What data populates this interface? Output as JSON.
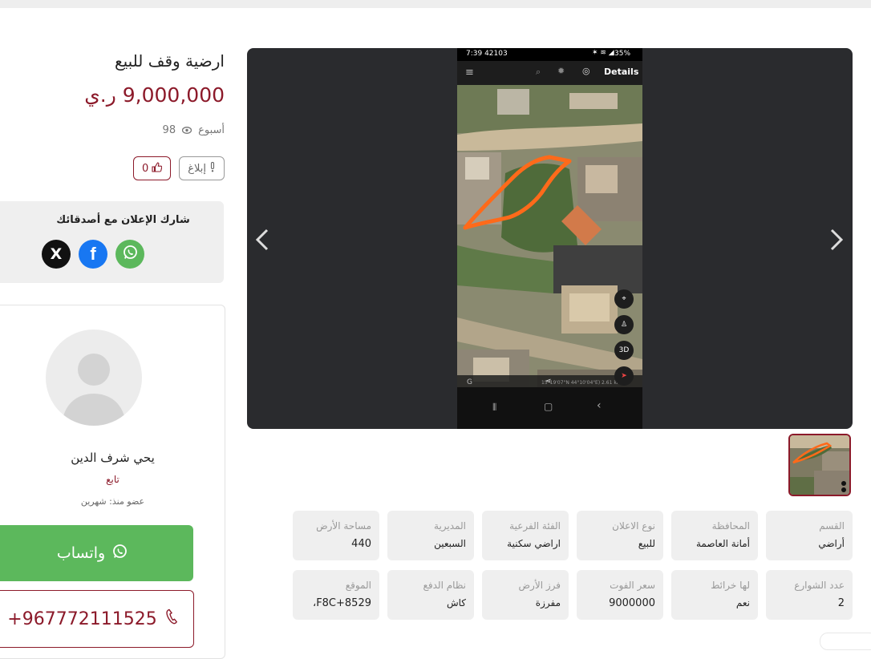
{
  "listing": {
    "title": "ارضية وقف للبيع",
    "price": "9,000,000 ر.ي",
    "posted": "أسبوع",
    "views": "98",
    "report_label": "إبلاغ",
    "likes": "0"
  },
  "share": {
    "title": "شارك الإعلان مع أصدقائك",
    "x_label": "X",
    "facebook_label": "f"
  },
  "seller": {
    "name": "يحي شرف الدين",
    "follow_label": "تابع",
    "member_since": "عضو منذ: شهرين",
    "whatsapp_label": "واتساب",
    "phone": "+967772111525"
  },
  "photo": {
    "status_time": "7:39 42103",
    "status_battery": "35%",
    "app_details": "Details",
    "map_3d": "3D",
    "coords": "15°19'07\"N 44°10'04\"E) 2.61 km"
  },
  "specs_row1": [
    {
      "label": "القسم",
      "value": "أراضي"
    },
    {
      "label": "المحافظة",
      "value": "أمانة العاصمة"
    },
    {
      "label": "نوع الاعلان",
      "value": "للبيع"
    },
    {
      "label": "الفئة الفرعية",
      "value": "اراضي سكنية"
    },
    {
      "label": "المديرية",
      "value": "السبعين"
    },
    {
      "label": "مساحة الأرض",
      "value": "440"
    }
  ],
  "specs_row2": [
    {
      "label": "عدد الشوارع",
      "value": "2"
    },
    {
      "label": "لها خرائط",
      "value": "نعم"
    },
    {
      "label": "سعر الفوت",
      "value": "9000000"
    },
    {
      "label": "فرز الأرض",
      "value": "مفرزة"
    },
    {
      "label": "نظام الدفع",
      "value": "كاش"
    },
    {
      "label": "الموقع",
      "value": "F8C+8529،"
    }
  ],
  "colors": {
    "accent": "#8c1a2a",
    "whatsapp": "#5cb85c",
    "facebook": "#1877f2",
    "x": "#111111",
    "gallery_bg": "#2a2b2e"
  }
}
